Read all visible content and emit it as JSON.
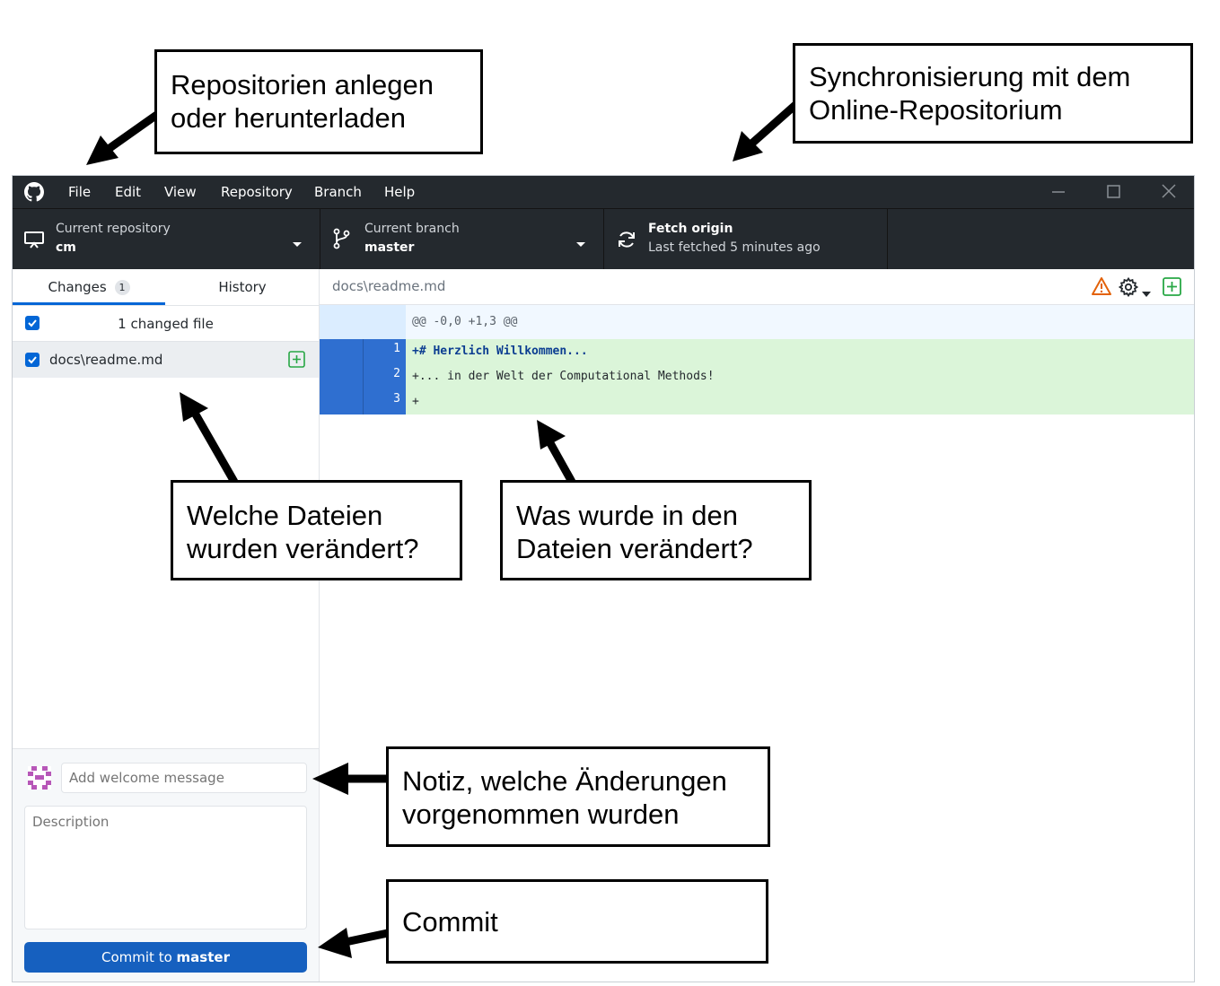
{
  "menu": {
    "file": "File",
    "edit": "Edit",
    "view": "View",
    "repository": "Repository",
    "branch": "Branch",
    "help": "Help"
  },
  "toolbar": {
    "repo_label": "Current repository",
    "repo_value": "cm",
    "branch_label": "Current branch",
    "branch_value": "master",
    "fetch_label": "Fetch origin",
    "fetch_status": "Last fetched 5 minutes ago"
  },
  "tabs": {
    "changes": "Changes",
    "changes_count": "1",
    "history": "History"
  },
  "files": {
    "summary": "1 changed file",
    "items": [
      {
        "path": "docs\\readme.md"
      }
    ]
  },
  "diff": {
    "file_path": "docs\\readme.md",
    "hunk_header": "@@ -0,0 +1,3 @@",
    "lines": [
      {
        "num": "1",
        "text": "+# Herzlich Willkommen..."
      },
      {
        "num": "2",
        "text": "+... in der Welt der Computational Methods!"
      },
      {
        "num": "3",
        "text": "+"
      }
    ]
  },
  "commit": {
    "summary_placeholder": "Add welcome message",
    "description_placeholder": "Description",
    "button_prefix": "Commit to ",
    "button_branch": "master"
  },
  "annotations": {
    "repo_line1": "Repositorien anlegen",
    "repo_line2": "oder herunterladen",
    "sync_line1": "Synchronisierung mit dem",
    "sync_line2": "Online-Repositorium",
    "files_line1": "Welche Dateien",
    "files_line2": "wurden verändert?",
    "diff_line1": "Was wurde in den",
    "diff_line2": "Dateien verändert?",
    "note_line1": "Notiz, welche Änderungen",
    "note_line2": "vorgenommen wurden",
    "commit": "Commit"
  },
  "colors": {
    "titlebar": "#24292e",
    "accent": "#0366d6",
    "added_bg": "#dbf5d9",
    "added_gutter": "#2f6fd0",
    "warning": "#e36209",
    "add_icon": "#28a745"
  }
}
